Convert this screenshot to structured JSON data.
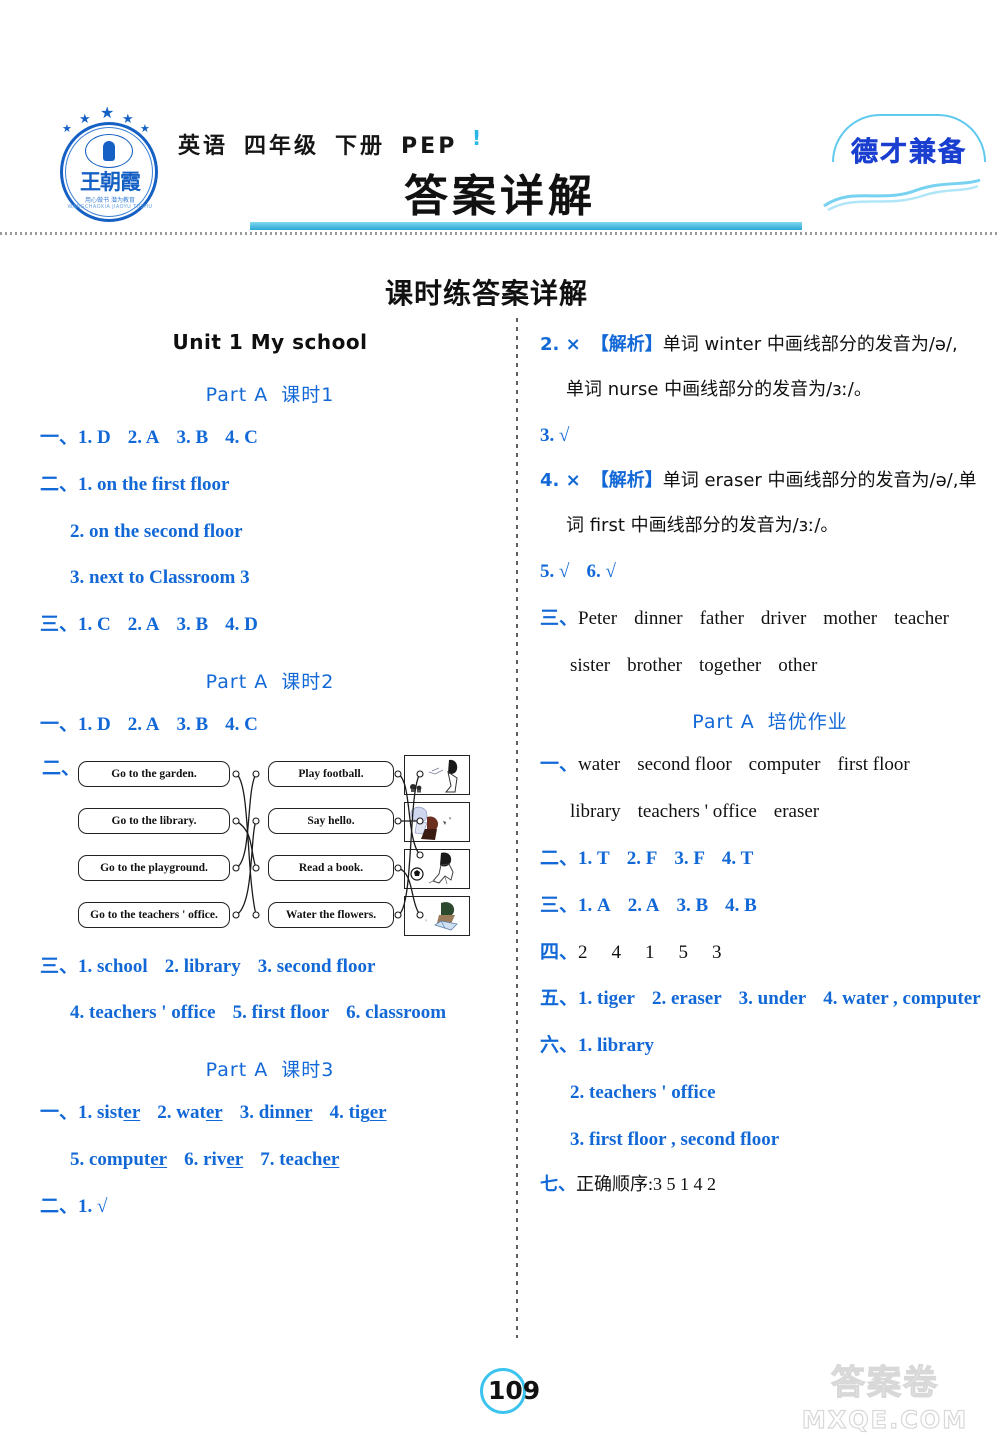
{
  "header": {
    "seal": {
      "name": "王朝霞",
      "motto": "用心做书  潜为教育",
      "arc": "WANGCHAOXIA  JIAOYU  TUSHU",
      "stars": 5
    },
    "subject": "英语",
    "grade": "四年级",
    "volume": "下册",
    "edition": "PEP",
    "pep_mark": "!",
    "right_logo": "德才兼备",
    "title": "答案详解"
  },
  "section_heading": "课时练答案详解",
  "left_column": {
    "unit_title": "Unit 1   My school",
    "blocks": [
      {
        "type": "part_head",
        "part": "Part A",
        "lesson": "课时1"
      },
      {
        "type": "answer",
        "marker": "一、",
        "items": [
          "1. D",
          "2. A",
          "3. B",
          "4. C"
        ]
      },
      {
        "type": "answer",
        "marker": "二、",
        "items": [
          "1. on the first floor"
        ]
      },
      {
        "type": "answer_indent",
        "items": [
          "2. on the second floor"
        ]
      },
      {
        "type": "answer_indent",
        "items": [
          "3. next to Classroom 3"
        ]
      },
      {
        "type": "answer",
        "marker": "三、",
        "items": [
          "1. C",
          "2. A",
          "3. B",
          "4. D"
        ]
      },
      {
        "type": "part_head",
        "part": "Part A",
        "lesson": "课时2"
      },
      {
        "type": "answer",
        "marker": "一、",
        "items": [
          "1. D",
          "2. A",
          "3. B",
          "4. C"
        ]
      },
      {
        "type": "matching",
        "marker": "二、"
      },
      {
        "type": "answer",
        "marker": "三、",
        "items": [
          "1. school",
          "2. library",
          "3. second floor"
        ]
      },
      {
        "type": "answer_indent",
        "items": [
          "4. teachers ' office",
          "5. first floor",
          "6. classroom"
        ]
      },
      {
        "type": "part_head",
        "part": "Part A",
        "lesson": "课时3"
      },
      {
        "type": "answer_underline",
        "marker": "一、",
        "items": [
          "1. sister",
          "2. water",
          "3. dinner",
          "4. tiger"
        ]
      },
      {
        "type": "answer_underline_indent",
        "items": [
          "5. computer",
          "6. river",
          "7. teacher"
        ]
      },
      {
        "type": "answer",
        "marker": "二、",
        "items": [
          "1. √"
        ]
      }
    ],
    "matching": {
      "left_boxes": [
        "Go to the garden.",
        "Go to the library.",
        "Go to the playground.",
        "Go to the teachers ' office."
      ],
      "middle_boxes": [
        "Play football.",
        "Say hello.",
        "Read a book.",
        "Water the flowers."
      ],
      "pictures": [
        "girl-watering-flowers-picture",
        "children-greeting-picture",
        "boy-playing-football-picture",
        "child-reading-book-picture"
      ]
    }
  },
  "right_column": {
    "blocks": [
      {
        "type": "explain",
        "num": "2. ×",
        "tag": "【解析】",
        "line1": "单词 winter 中画线部分的发音为/ə/,",
        "line2": "单词 nurse 中画线部分的发音为/ɜː/。"
      },
      {
        "type": "answer",
        "items": [
          "3. √"
        ]
      },
      {
        "type": "explain",
        "num": "4. ×",
        "tag": "【解析】",
        "line1": "单词 eraser 中画线部分的发音为/ə/,单",
        "line2": "词 first 中画线部分的发音为/ɜː/。"
      },
      {
        "type": "answer",
        "items": [
          "5. √",
          "6. √"
        ]
      },
      {
        "type": "word_list",
        "marker": "三、",
        "line1": [
          "Peter",
          "dinner",
          "father",
          "driver",
          "mother",
          "teacher"
        ],
        "line2": [
          "sister",
          "brother",
          "together",
          "other"
        ]
      },
      {
        "type": "part_head",
        "part": "Part A",
        "lesson": "培优作业"
      },
      {
        "type": "word_list",
        "marker": "一、",
        "line1": [
          "water",
          "second floor",
          "computer",
          "first floor"
        ],
        "line2": [
          "library",
          "teachers ' office",
          "eraser"
        ]
      },
      {
        "type": "answer",
        "marker": "二、",
        "items": [
          "1. T",
          "2. F",
          "3. F",
          "4. T"
        ]
      },
      {
        "type": "answer",
        "marker": "三、",
        "items": [
          "1. A",
          "2. A",
          "3. B",
          "4. B"
        ]
      },
      {
        "type": "answer_plain",
        "marker": "四、",
        "items": [
          "2",
          "4",
          "1",
          "5",
          "3"
        ]
      },
      {
        "type": "answer",
        "marker": "五、",
        "items": [
          "1. tiger",
          "2. eraser",
          "3. under",
          "4. water , computer"
        ]
      },
      {
        "type": "answer",
        "marker": "六、",
        "items": [
          "1. library"
        ]
      },
      {
        "type": "answer_indent",
        "items": [
          "2. teachers ' office"
        ]
      },
      {
        "type": "answer_indent",
        "items": [
          "3. first floor , second floor"
        ]
      },
      {
        "type": "answer_cn",
        "marker": "七、",
        "text": "正确顺序:3   5   1   4   2"
      }
    ]
  },
  "footer": {
    "page_number": "109",
    "watermark_cn": "答案卷",
    "watermark_en": "MXQE.COM"
  },
  "colors": {
    "accent_blue": "#1268d6",
    "cyan": "#2ba6d4",
    "seal_blue": "#1560c4"
  }
}
